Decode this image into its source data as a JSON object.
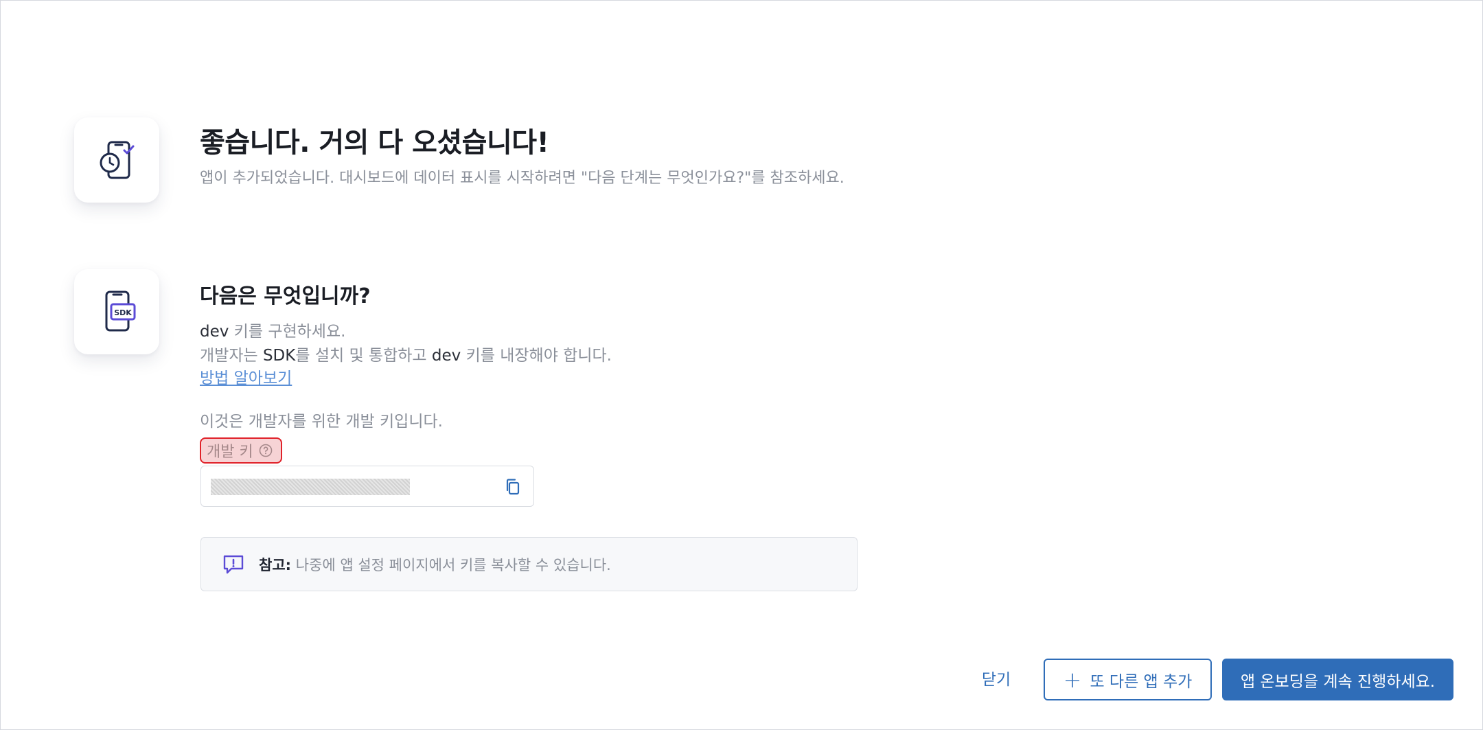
{
  "success": {
    "icon": "phone-clock-check-icon",
    "title": "좋습니다. 거의 다 오셨습니다!",
    "subtitle": "앱이 추가되었습니다. 대시보드에 데이터 표시를 시작하려면 \"다음 단계는 무엇인가요?\"를 참조하세요."
  },
  "next_steps": {
    "icon": "phone-sdk-icon",
    "title": "다음은 무엇입니까?",
    "line1_a": "dev",
    "line1_b": " 키를 구현하세요.",
    "line2_a": "개발자는 ",
    "line2_b": "SDK",
    "line2_c": "를 설치 및 통합하고 ",
    "line2_d": "dev",
    "line2_e": " 키를 내장해야 합니다.",
    "learn_link": "방법 알아보기",
    "dev_key_intro": "이것은 개발자를 위한 개발 키입니다.",
    "dev_key_label": "개발 키",
    "dev_key_value": "••••••••••••••••••••••••••••••••"
  },
  "note": {
    "bold": "참고:",
    "text": " 나중에 앱 설정 페이지에서 키를 복사할 수 있습니다."
  },
  "footer": {
    "close_label": "닫기",
    "add_label": "또 다른 앱 추가",
    "continue_label": "앱 온보딩을 계속 진행하세요."
  },
  "colors": {
    "primary": "#2f6db8",
    "highlight_border": "#e0222a",
    "highlight_fill": "#f6d3d5",
    "icon_purple": "#5b4bd6"
  }
}
